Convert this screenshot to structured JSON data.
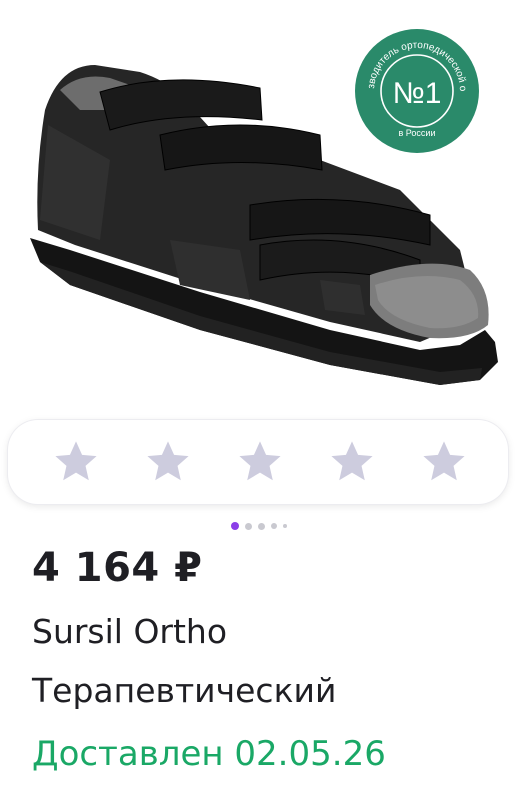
{
  "product": {
    "image_alt": "Sursil Ortho orthopedic shoe",
    "badge": {
      "main": "№1",
      "arc_text": "Производитель ортопедической обуви",
      "bottom_text": "в России",
      "color": "#2a8a6a"
    }
  },
  "rating": {
    "stars": [
      {
        "name": "star-1"
      },
      {
        "name": "star-2"
      },
      {
        "name": "star-3"
      },
      {
        "name": "star-4"
      },
      {
        "name": "star-5"
      }
    ],
    "star_color": "#cdccde",
    "filled": 0
  },
  "carousel": {
    "active_index": 0,
    "active_color": "#8b3fe8",
    "inactive_color": "#c9c9d0"
  },
  "price": "4 164 ₽",
  "title": {
    "line1": "Sursil Ortho",
    "line2": "Терапевтический"
  },
  "delivery": {
    "text": "Доставлен 02.05.26",
    "color": "#1aa866"
  }
}
